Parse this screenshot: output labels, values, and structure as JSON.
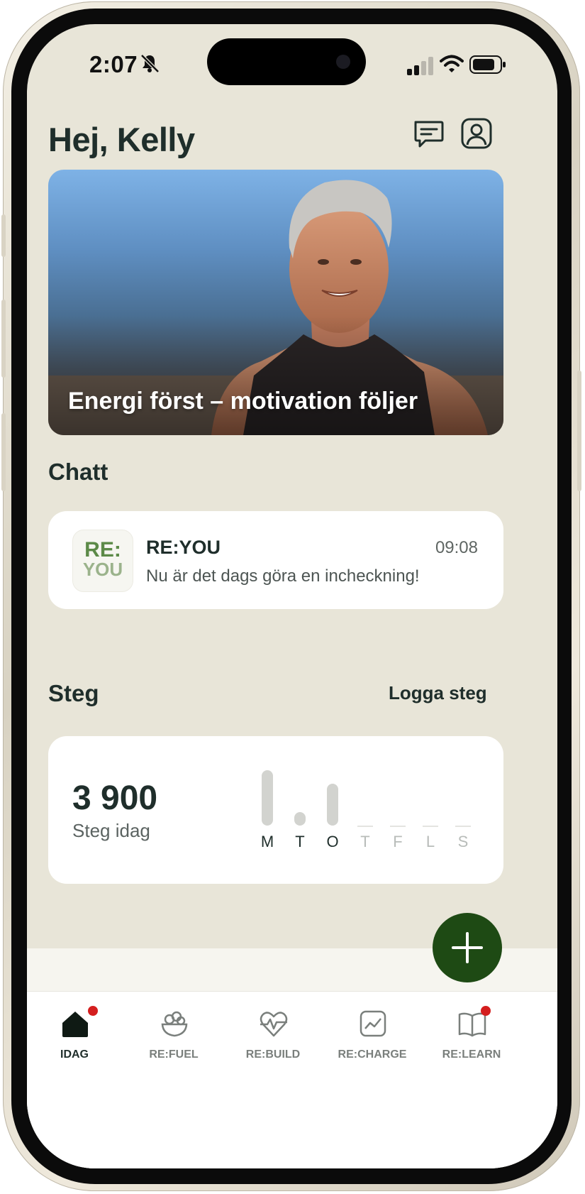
{
  "status": {
    "time": "2:07"
  },
  "header": {
    "greeting": "Hej, Kelly"
  },
  "hero": {
    "title": "Energi först – motivation följer"
  },
  "chat": {
    "section_title": "Chatt",
    "logo_line1": "RE:",
    "logo_line2": "YOU",
    "sender": "RE:YOU",
    "time": "09:08",
    "message": "Nu är det dags göra en incheckning!"
  },
  "steps": {
    "section_title": "Steg",
    "log_link": "Logga steg",
    "value": "3 900",
    "label": "Steg idag",
    "days": [
      "M",
      "T",
      "O",
      "T",
      "F",
      "L",
      "S"
    ]
  },
  "chart_data": {
    "type": "bar",
    "categories": [
      "M",
      "T",
      "O",
      "T",
      "F",
      "L",
      "S"
    ],
    "values": [
      7800,
      1900,
      5900,
      0,
      0,
      0,
      0
    ]
  },
  "tabs": [
    {
      "label": "IDAG",
      "icon": "home-icon",
      "active": true,
      "badge": true
    },
    {
      "label": "RE:FUEL",
      "icon": "salad-bowl-icon",
      "active": false,
      "badge": false
    },
    {
      "label": "RE:BUILD",
      "icon": "heart-pulse-icon",
      "active": false,
      "badge": false
    },
    {
      "label": "RE:CHARGE",
      "icon": "chart-frame-icon",
      "active": false,
      "badge": false
    },
    {
      "label": "RE:LEARN",
      "icon": "open-book-icon",
      "active": false,
      "badge": true
    }
  ],
  "colors": {
    "background": "#e8e5d8",
    "text": "#1f2e2b",
    "fab": "#1e4a14",
    "badge": "#d41e1e",
    "logo_green": "#5c8a48"
  }
}
